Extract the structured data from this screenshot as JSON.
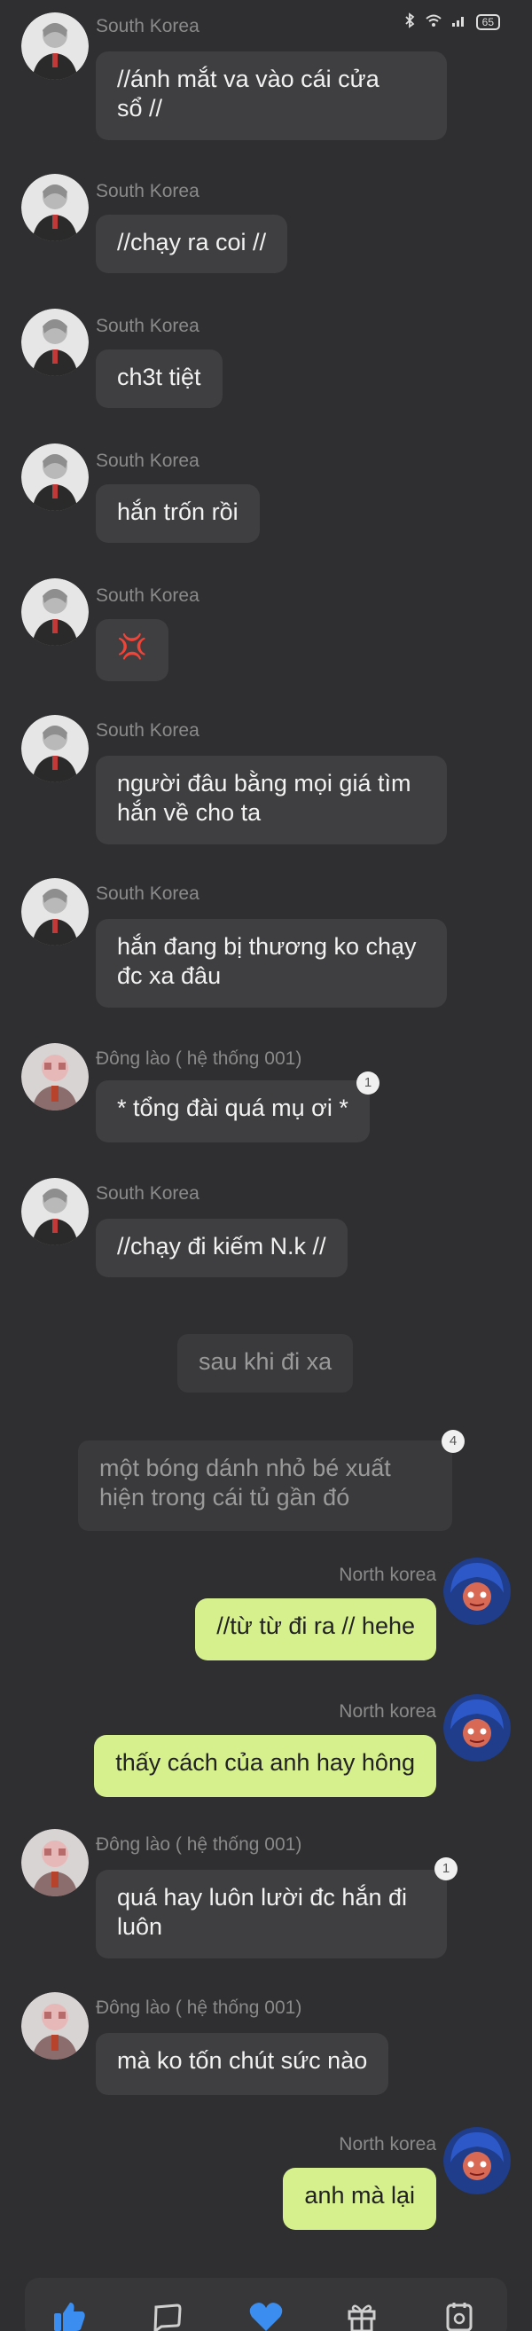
{
  "status_bar": {
    "battery": "65"
  },
  "messages": [
    {
      "sender": "South Korea",
      "text": "//ánh mắt va vào cái cửa\nsổ //"
    },
    {
      "sender": "South Korea",
      "text": "//chạy ra coi //"
    },
    {
      "sender": "South Korea",
      "text": "ch3t tiệt"
    },
    {
      "sender": "South Korea",
      "text": "hắn trốn rồi"
    },
    {
      "sender": "South Korea",
      "text": "💢"
    },
    {
      "sender": "South Korea",
      "text": "người đâu bằng mọi giá tìm\nhắn về cho ta"
    },
    {
      "sender": "South Korea",
      "text": "hắn đang bị thương ko chạy\nđc xa đâu"
    },
    {
      "sender": "Đông lào ( hệ thống 001)",
      "text": "* tổng đài quá mụ ơi *",
      "badge": "1"
    },
    {
      "sender": "South Korea",
      "text": "//chạy đi kiếm N.k //"
    },
    {
      "note": "sau khi đi xa"
    },
    {
      "note": "một bóng dánh nhỏ bé xuất\nhiện trong cái tủ gần đó",
      "badge": "4"
    },
    {
      "sender": "North korea",
      "text": "//từ từ đi ra // hehe",
      "mine": true
    },
    {
      "sender": "North korea",
      "text": "thấy cách của anh hay hông",
      "mine": true
    },
    {
      "sender": "Đông lào ( hệ thống 001)",
      "text": "quá hay luôn lười đc hắn đi\nluôn",
      "badge": "1"
    },
    {
      "sender": "Đông lào ( hệ thống 001)",
      "text": "mà ko tốn chút sức nào"
    },
    {
      "sender": "North korea",
      "text": "anh mà lại",
      "mine": true
    }
  ],
  "toolbar": {
    "icons": [
      "thumbs-up-icon",
      "chat-bubble-icon",
      "heart-icon",
      "gift-icon",
      "badge-icon"
    ]
  },
  "colors": {
    "background": "#2f2f31",
    "bubble": "#3f3f41",
    "my_bubble": "#d5f08c",
    "accent": "#3b8ef0"
  }
}
